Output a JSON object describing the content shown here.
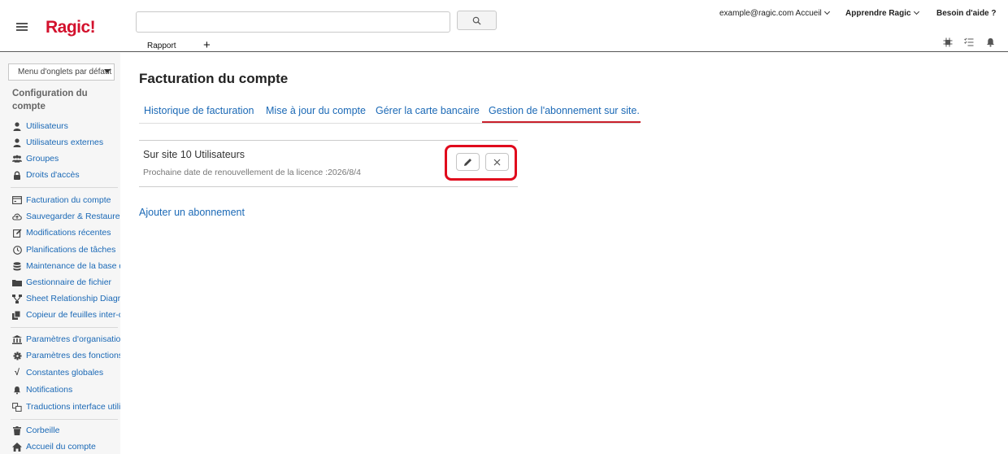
{
  "brand": {
    "logo": "Ragic!"
  },
  "header": {
    "search": {
      "value": "",
      "placeholder": ""
    },
    "user_menu": "example@ragic.com Accueil",
    "learn_menu": "Apprendre Ragic",
    "help_link": "Besoin d'aide ?",
    "tabs": [
      {
        "label": "Rapport"
      }
    ],
    "add_tab_label": "+"
  },
  "sidebar": {
    "tab_selector": "Menu d'onglets par défaut",
    "heading": "Configuration du compte",
    "groups": [
      [
        {
          "label": "Utilisateurs",
          "icon": "user-icon"
        },
        {
          "label": "Utilisateurs externes",
          "icon": "user-icon"
        },
        {
          "label": "Groupes",
          "icon": "group-icon"
        },
        {
          "label": "Droits d'accès",
          "icon": "lock-icon"
        }
      ],
      [
        {
          "label": "Facturation du compte",
          "icon": "billing-icon"
        },
        {
          "label": "Sauvegarder & Restaurer",
          "icon": "cloud-backup-icon"
        },
        {
          "label": "Modifications récentes",
          "icon": "edit-icon"
        },
        {
          "label": "Planifications de tâches",
          "icon": "clock-icon"
        },
        {
          "label": "Maintenance de la base de données",
          "icon": "database-icon"
        },
        {
          "label": "Gestionnaire de fichier",
          "icon": "folder-icon"
        },
        {
          "label": "Sheet Relationship Diagram",
          "icon": "diagram-icon"
        },
        {
          "label": "Copieur de feuilles inter-comptes",
          "icon": "copy-icon"
        }
      ],
      [
        {
          "label": "Paramètres d'organisation",
          "icon": "bank-icon"
        },
        {
          "label": "Paramètres des fonctions",
          "icon": "gear-icon"
        },
        {
          "label": "Constantes globales",
          "icon": "sqrt-icon"
        },
        {
          "label": "Notifications",
          "icon": "bell-icon"
        },
        {
          "label": "Traductions interface utilisateur",
          "icon": "translate-icon"
        }
      ],
      [
        {
          "label": "Corbeille",
          "icon": "trash-icon"
        },
        {
          "label": "Accueil du compte",
          "icon": "home-icon"
        }
      ]
    ]
  },
  "main": {
    "title": "Facturation du compte",
    "subtabs": [
      {
        "label": "Historique de facturation",
        "active": false
      },
      {
        "label": "Mise à jour du compte",
        "active": false
      },
      {
        "label": "Gérer la carte bancaire",
        "active": false
      },
      {
        "label": "Gestion de l'abonnement sur site.",
        "active": true
      }
    ],
    "subscription": {
      "title": "Sur site 10 Utilisateurs",
      "renewal": "Prochaine date de renouvellement de la licence :2026/8/4"
    },
    "add_link": "Ajouter un abonnement"
  },
  "colors": {
    "brand_red": "#d3112d",
    "link_blue": "#1b69b6",
    "active_tab_underline": "#c9202b",
    "highlight_red": "#e0091c"
  }
}
